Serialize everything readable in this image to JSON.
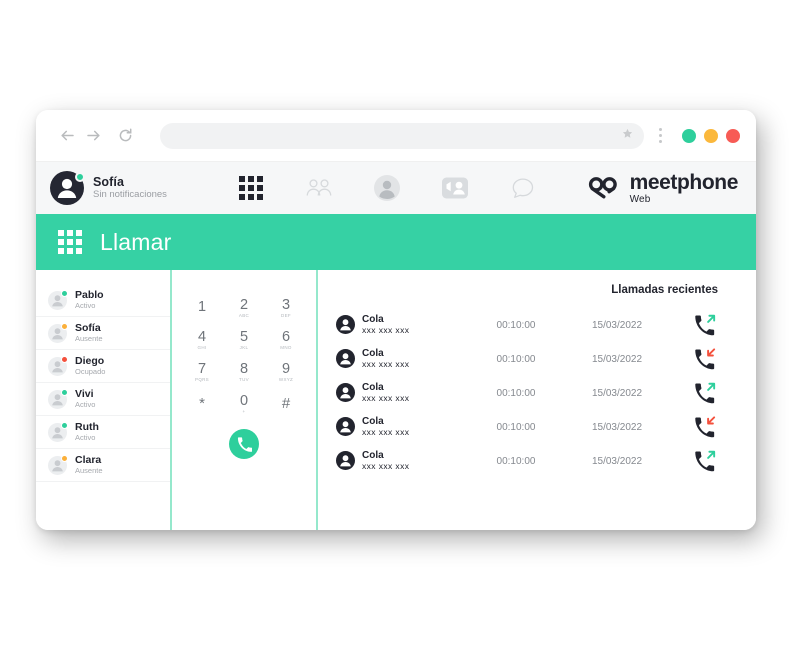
{
  "browser": {
    "back_label": "back-arrow",
    "forward_label": "forward-arrow",
    "reload_label": "reload",
    "url_value": "",
    "url_placeholder": "",
    "bookmark_label": "star",
    "menu_label": "more-options",
    "window_dots": [
      {
        "name": "minimize",
        "color": "#2ecf9c"
      },
      {
        "name": "maximize",
        "color": "#fbb83c"
      },
      {
        "name": "close",
        "color": "#f75b55"
      }
    ]
  },
  "header": {
    "user": {
      "name": "Sofía",
      "subtitle": "Sin notificaciones",
      "status_color": "#2ecf9c"
    },
    "nav": [
      {
        "icon": "dialpad-grid-icon",
        "label": "Llamar",
        "active": true
      },
      {
        "icon": "contacts-group-icon",
        "label": "Contactos",
        "active": false
      },
      {
        "icon": "profile-person-icon",
        "label": "Perfil",
        "active": false
      },
      {
        "icon": "video-call-icon",
        "label": "Videollamada",
        "active": false
      },
      {
        "icon": "chat-bubble-icon",
        "label": "Chat",
        "active": false
      }
    ],
    "brand": {
      "name": "meetphone",
      "sub": "Web",
      "mark": "meetphone-logo-icon"
    }
  },
  "banner": {
    "icon": "dialpad-grid-icon",
    "title": "Llamar",
    "color": "#36d1a4"
  },
  "contacts": [
    {
      "name": "Pablo",
      "status": "Activo",
      "status_color": "#2ecf9c"
    },
    {
      "name": "Sofía",
      "status": "Ausente",
      "status_color": "#fbb03b"
    },
    {
      "name": "Diego",
      "status": "Ocupado",
      "status_color": "#f4503c"
    },
    {
      "name": "Vivi",
      "status": "Activo",
      "status_color": "#2ecf9c"
    },
    {
      "name": "Ruth",
      "status": "Activo",
      "status_color": "#2ecf9c"
    },
    {
      "name": "Clara",
      "status": "Ausente",
      "status_color": "#fbb03b"
    }
  ],
  "dialpad": {
    "keys": [
      {
        "num": "1",
        "sub": ""
      },
      {
        "num": "2",
        "sub": "ABC"
      },
      {
        "num": "3",
        "sub": "DEF"
      },
      {
        "num": "4",
        "sub": "GHI"
      },
      {
        "num": "5",
        "sub": "JKL"
      },
      {
        "num": "6",
        "sub": "MNO"
      },
      {
        "num": "7",
        "sub": "PQRS"
      },
      {
        "num": "8",
        "sub": "TUV"
      },
      {
        "num": "9",
        "sub": "WXYZ"
      },
      {
        "num": "*",
        "sub": ""
      },
      {
        "num": "0",
        "sub": "+"
      },
      {
        "num": "#",
        "sub": ""
      }
    ],
    "call_button": "call-button",
    "call_button_color": "#2ecf9c"
  },
  "recent": {
    "title": "Llamadas recientes",
    "calls": [
      {
        "name": "Cola",
        "number": "xxx xxx xxx",
        "duration": "00:10:00",
        "date": "15/03/2022",
        "direction": "outgoing"
      },
      {
        "name": "Cola",
        "number": "xxx xxx xxx",
        "duration": "00:10:00",
        "date": "15/03/2022",
        "direction": "incoming"
      },
      {
        "name": "Cola",
        "number": "xxx xxx xxx",
        "duration": "00:10:00",
        "date": "15/03/2022",
        "direction": "outgoing"
      },
      {
        "name": "Cola",
        "number": "xxx xxx xxx",
        "duration": "00:10:00",
        "date": "15/03/2022",
        "direction": "incoming"
      },
      {
        "name": "Cola",
        "number": "xxx xxx xxx",
        "duration": "00:10:00",
        "date": "15/03/2022",
        "direction": "outgoing"
      }
    ],
    "outgoing_color": "#2ecf9c",
    "incoming_color": "#f4503c",
    "handset_color": "#22242e"
  }
}
